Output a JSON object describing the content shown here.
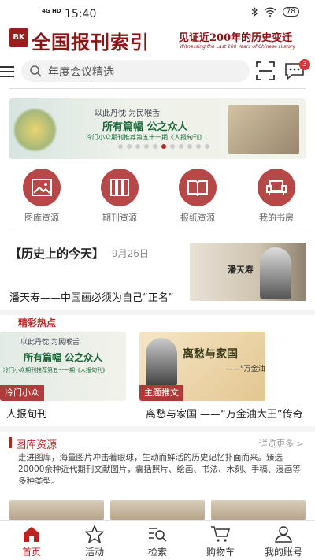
{
  "status": {
    "network": "4G HD",
    "time": "15:40",
    "battery": "78"
  },
  "brand": {
    "logo_mark": "BK",
    "name": "全国报刊索引",
    "slogan": "见证近200年的历史变迁",
    "slogan_en": "Witnessing the Last 200 Years of Chinese History"
  },
  "search": {
    "placeholder": "年度会议精选",
    "message_count": "3"
  },
  "banner": {
    "line1": "以此丹忱   为民喉舌",
    "line2": "所有篇幅   公之众人",
    "line3": "冷门小众期刊推荐第五十一期《人报旬刊》"
  },
  "categories": [
    {
      "label": "图库资源",
      "icon": "image-icon"
    },
    {
      "label": "期刊资源",
      "icon": "journals-icon"
    },
    {
      "label": "报纸资源",
      "icon": "open-book-icon"
    },
    {
      "label": "我的书房",
      "icon": "armchair-icon"
    }
  ],
  "today": {
    "title": "【历史上的今天】",
    "date": "9月26日",
    "subtitle": "潘天寿——中国画必须为自己“正名”",
    "image_name": "潘天寿"
  },
  "hot": {
    "section_title": "精彩热点",
    "cards": [
      {
        "tag": "冷门小众",
        "label": "人报旬刊",
        "line1": "以此丹忱   为民喉舌",
        "line2": "所有篇幅   公之众人",
        "line3": "冷门小众期刊推荐第五十一期《人报旬刊》"
      },
      {
        "tag": "主题推文",
        "label": "离愁与家国 ——“万金油大王”传奇",
        "line1": "离愁与家国",
        "line2": "——“万金油"
      }
    ]
  },
  "gallery": {
    "title": "图库资源",
    "more": "详览更多 >",
    "description": "走进图库，海量图片冲击着眼球，生动而鲜活的历史记忆扑面而来。臻选20000余种近代期刊文献图片，囊括照片、绘画、书法、木刻、手稿、漫画等多种类型。"
  },
  "tabs": [
    {
      "label": "首页",
      "icon": "home-icon",
      "active": true
    },
    {
      "label": "活动",
      "icon": "star-icon"
    },
    {
      "label": "检索",
      "icon": "search-list-icon"
    },
    {
      "label": "购物车",
      "icon": "cart-icon"
    },
    {
      "label": "我的账号",
      "icon": "user-icon"
    }
  ],
  "colors": {
    "accent": "#b22222",
    "category_circle": "#b64848"
  }
}
